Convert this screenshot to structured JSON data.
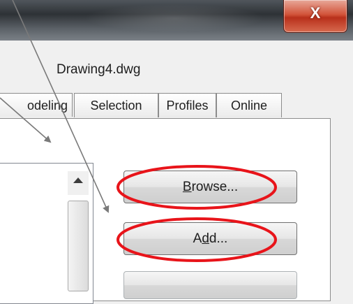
{
  "window": {
    "close_label": "X",
    "document_name": "Drawing4.dwg"
  },
  "tabs": [
    {
      "label": "odeling"
    },
    {
      "label": "Selection"
    },
    {
      "label": "Profiles"
    },
    {
      "label": "Online"
    }
  ],
  "buttons": {
    "browse": {
      "pre": "",
      "mnemonic": "B",
      "post": "rowse..."
    },
    "add": {
      "pre": "A",
      "mnemonic": "d",
      "post": "d..."
    }
  },
  "annotations": {
    "highlight_color": "#e8141a",
    "arrow_color": "#7a7a7a"
  }
}
